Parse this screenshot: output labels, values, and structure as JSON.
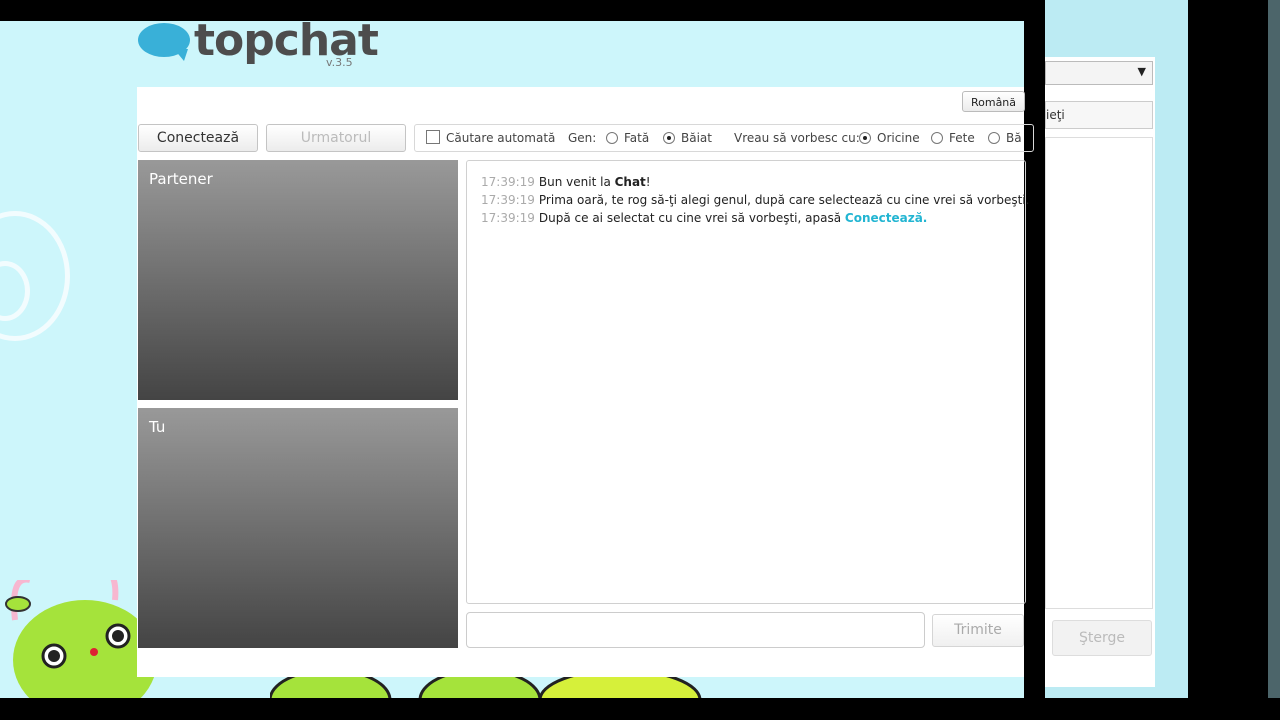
{
  "logo": {
    "text": "topchat",
    "version": "v.3.5"
  },
  "language": {
    "selected": "Română"
  },
  "toolbar": {
    "connect_label": "Conectează",
    "next_label": "Urmatorul",
    "auto_search_label": "Căutare automată",
    "gender_label": "Gen:",
    "gender_options": [
      "Fată",
      "Băiat"
    ],
    "gender_selected": "Băiat",
    "talk_to_label": "Vreau să vorbesc cu:",
    "talk_to_options": [
      "Oricine",
      "Fete",
      "Bă"
    ],
    "talk_to_selected": "Oricine"
  },
  "video": {
    "partner_label": "Partener",
    "you_label": "Tu"
  },
  "chat": {
    "messages": [
      {
        "time": "17:39:19",
        "before": "Bun venit la ",
        "bold": "Chat",
        "after": "!"
      },
      {
        "time": "17:39:19",
        "text": "Prima oară, te rog să-ţi alegi genul, după care selectează cu cine vrei să vorbeşti."
      },
      {
        "time": "17:39:19",
        "before": "După ce ai selectat cu cine vrei să vorbeşti, apasă ",
        "link": "Conectează",
        "after": "."
      }
    ],
    "input_value": "",
    "send_label": "Trimite"
  },
  "side_panel": {
    "tab_label": "ieţi",
    "clear_label": "Şterge"
  },
  "colors": {
    "background": "#cdf6fb",
    "accent": "#22b5d2",
    "logo_blue": "#39b0d8"
  }
}
